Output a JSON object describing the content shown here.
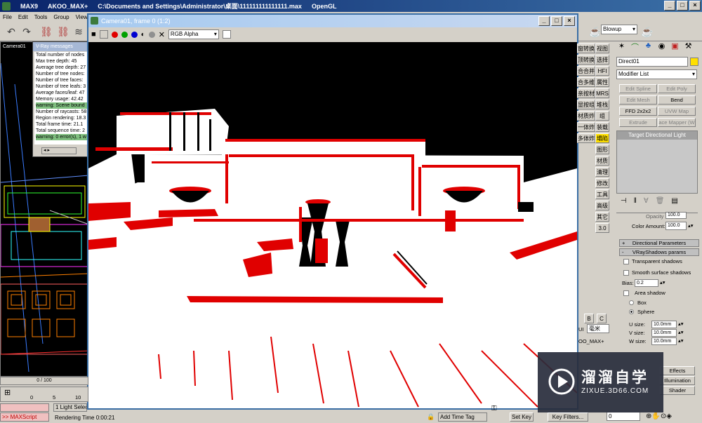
{
  "app": {
    "title_parts": [
      "MAX9",
      "AKOO_MAX+",
      "C:\\Documents and Settings\\Administrator\\桌面\\111111111111111.max",
      "OpenGL"
    ],
    "window_buttons": [
      "_",
      "□",
      "×"
    ]
  },
  "menu": [
    "File",
    "Edit",
    "Tools",
    "Group",
    "Views"
  ],
  "viewport": {
    "label": "Camera01"
  },
  "vray_messages": {
    "title": "V-Ray messages",
    "lines": [
      "Total number of nodes",
      "Max tree depth: 45",
      "Average tree depth: 27",
      "Number of tree nodes:",
      "Number of tree faces:",
      "Number of tree leafs: 3",
      "Average faces/leaf: 47",
      "Memory usage: 42.42",
      "warning: Scene bound",
      "Number of raycasts: 58",
      "Region rendering: 18.3",
      "Total frame time: 21.1",
      "Total sequence time: 2",
      "warning: 0 error(s), 1 w"
    ],
    "warn_indices": [
      8,
      13
    ]
  },
  "render_window": {
    "title": "Camera01, frame 0 (1:2)",
    "channel": "RGB Alpha",
    "window_buttons": [
      "_",
      "□",
      "×"
    ]
  },
  "cn_buttons": [
    [
      "窗转换",
      "视图"
    ],
    [
      "顶转换",
      "选择"
    ],
    [
      "合合并",
      "HFI"
    ],
    [
      "合多维",
      "属性"
    ],
    [
      "亲按材",
      "MRS"
    ],
    [
      "显按组",
      "堆栈"
    ],
    [
      "材质炸",
      "组"
    ],
    [
      "一体炸",
      "装载"
    ],
    [
      "多体炸",
      "塌陷"
    ],
    [
      "",
      "图形"
    ],
    [
      "",
      "材质"
    ],
    [
      "",
      "清理"
    ],
    [
      "",
      "修改"
    ],
    [
      "",
      "工具"
    ],
    [
      "",
      "高级"
    ],
    [
      "",
      "其它"
    ],
    [
      "",
      "3.0"
    ]
  ],
  "panel": {
    "blowup": "Blowup",
    "object_name": "Direct01",
    "modifier_list": "Modifier List",
    "mod_buttons": [
      "Edit Spline",
      "Edit Poly",
      "Edit Mesh",
      "Bend",
      "FFD 2x2x2",
      "UVW Map",
      "Extrude",
      "ace Mapper (W"
    ],
    "stack_item": "Target Directional Light",
    "opacity_label": "Opacity",
    "opacity_value": "100.0",
    "color_amount_label": "Color Amount:",
    "color_amount_value": "100.0",
    "rollouts": [
      "Directional Parameters",
      "VRayShadows params"
    ],
    "transparent_shadows": "Transparent shadows",
    "smooth_surface": "Smooth surface shadows",
    "bias_label": "Bias:",
    "bias_value": "0.2",
    "area_shadow": "Area shadow",
    "box": "Box",
    "sphere": "Sphere",
    "u_size_label": "U size:",
    "u_size": "10.0mm",
    "v_size_label": "V size:",
    "v_size": "10.0mm",
    "w_size_label": "W size:",
    "w_size": "10.0mm",
    "effects": "Effects",
    "illumination": "Illumination",
    "shader": "Shader"
  },
  "lower_mid": {
    "b_btn": "B",
    "c_btn": "C",
    "ui_label": "UI",
    "unit": "毫米",
    "akoo": "OO_MAX+"
  },
  "timeline": {
    "counter": "0 / 100",
    "ticks": [
      "0",
      "5",
      "10"
    ]
  },
  "status": {
    "selection": "1 Light Select",
    "maxscript": ">> MAXScript",
    "rendering_time": "Rendering Time  0:00:21",
    "add_time_tag": "Add Time Tag",
    "set_key": "Set Key",
    "key_filters": "Key Filters...",
    "frame": "0"
  },
  "watermark": {
    "title": "溜溜自学",
    "url": "ZIXUE.3D66.COM"
  },
  "colors": {
    "title_bar": "#0a246a",
    "render_bg": "#000000",
    "shadow_red": "#e00000",
    "highlight_yellow": "#ffe000"
  }
}
